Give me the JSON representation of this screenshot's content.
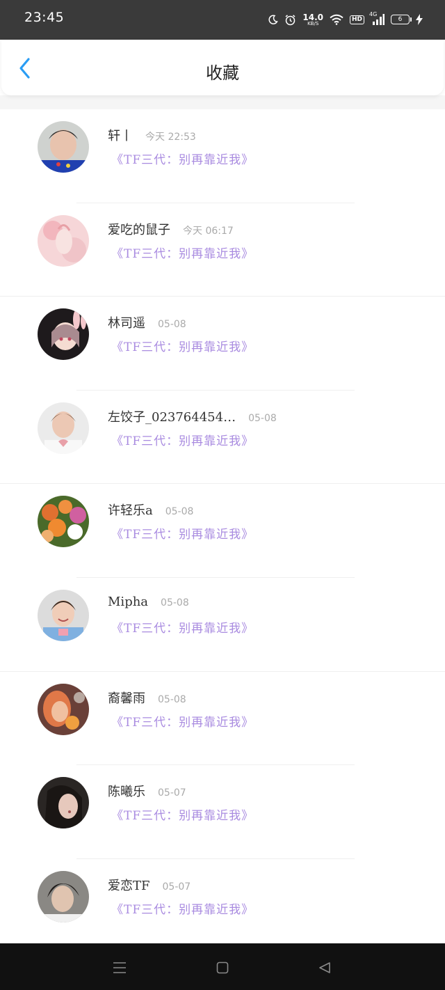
{
  "status_bar": {
    "time": "23:45",
    "net_speed": "14.0",
    "net_unit": "KB/S",
    "hd": "HD",
    "signal": "4G",
    "battery": "6"
  },
  "header": {
    "title": "收藏"
  },
  "colors": {
    "accent_back": "#2a9df4",
    "book_title": "#a98be0",
    "time_text": "#aaaaaa"
  },
  "items": [
    {
      "name": "轩丨",
      "time": "今天 22:53",
      "title": "《TF三代：别再靠近我》",
      "avatar": "avatar-boy-blue-shirt"
    },
    {
      "name": "爱吃的鼠子",
      "time": "今天 06:17",
      "title": "《TF三代：别再靠近我》",
      "avatar": "avatar-pink-anime"
    },
    {
      "name": "林司遥",
      "time": "05-08",
      "title": "《TF三代：别再靠近我》",
      "avatar": "avatar-anime-girl-bunny-ears"
    },
    {
      "name": "左饺子_023764454…",
      "time": "05-08",
      "title": "《TF三代：别再靠近我》",
      "avatar": "avatar-boy-heart-hands"
    },
    {
      "name": "许轻乐a",
      "time": "05-08",
      "title": "《TF三代：别再靠近我》",
      "avatar": "avatar-flowers"
    },
    {
      "name": "Mipha",
      "time": "05-08",
      "title": "《TF三代：别再靠近我》",
      "avatar": "avatar-boy-smiling"
    },
    {
      "name": "裔馨雨",
      "time": "05-08",
      "title": "《TF三代：别再靠近我》",
      "avatar": "avatar-girl-orange"
    },
    {
      "name": "陈曦乐",
      "time": "05-07",
      "title": "《TF三代：别再靠近我》",
      "avatar": "avatar-girl-dark"
    },
    {
      "name": "爱恋TF",
      "time": "05-07",
      "title": "《TF三代：别再靠近我》",
      "avatar": "avatar-boy-dark-hair"
    }
  ],
  "nav": {
    "menu": "menu-icon",
    "home": "home-icon",
    "back": "back-triangle-icon"
  }
}
